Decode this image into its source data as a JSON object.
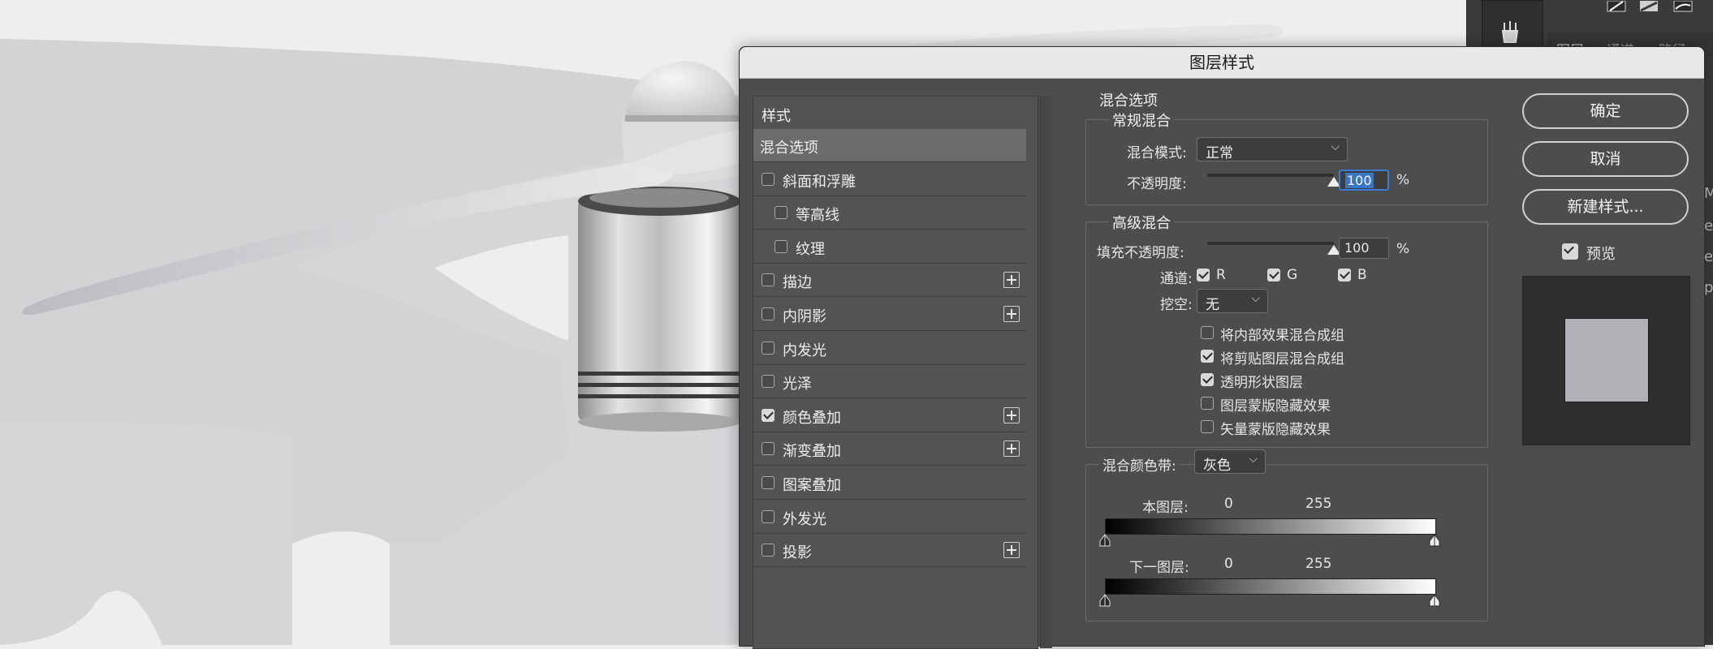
{
  "dialog": {
    "title": "图层样式",
    "styles_list": {
      "header": "样式",
      "items": [
        {
          "label": "混合选项",
          "has_checkbox": false,
          "checked": false,
          "has_plus": false,
          "selected": true,
          "indent": false
        },
        {
          "label": "斜面和浮雕",
          "has_checkbox": true,
          "checked": false,
          "has_plus": false,
          "selected": false,
          "indent": false
        },
        {
          "label": "等高线",
          "has_checkbox": true,
          "checked": false,
          "has_plus": false,
          "selected": false,
          "indent": true
        },
        {
          "label": "纹理",
          "has_checkbox": true,
          "checked": false,
          "has_plus": false,
          "selected": false,
          "indent": true
        },
        {
          "label": "描边",
          "has_checkbox": true,
          "checked": false,
          "has_plus": true,
          "selected": false,
          "indent": false
        },
        {
          "label": "内阴影",
          "has_checkbox": true,
          "checked": false,
          "has_plus": true,
          "selected": false,
          "indent": false
        },
        {
          "label": "内发光",
          "has_checkbox": true,
          "checked": false,
          "has_plus": false,
          "selected": false,
          "indent": false
        },
        {
          "label": "光泽",
          "has_checkbox": true,
          "checked": false,
          "has_plus": false,
          "selected": false,
          "indent": false
        },
        {
          "label": "颜色叠加",
          "has_checkbox": true,
          "checked": true,
          "has_plus": true,
          "selected": false,
          "indent": false
        },
        {
          "label": "渐变叠加",
          "has_checkbox": true,
          "checked": false,
          "has_plus": true,
          "selected": false,
          "indent": false
        },
        {
          "label": "图案叠加",
          "has_checkbox": true,
          "checked": false,
          "has_plus": false,
          "selected": false,
          "indent": false
        },
        {
          "label": "外发光",
          "has_checkbox": true,
          "checked": false,
          "has_plus": false,
          "selected": false,
          "indent": false
        },
        {
          "label": "投影",
          "has_checkbox": true,
          "checked": false,
          "has_plus": true,
          "selected": false,
          "indent": false
        }
      ]
    },
    "blending": {
      "section_title": "混合选项",
      "general": {
        "legend": "常规混合",
        "blend_mode_label": "混合模式:",
        "blend_mode_value": "正常",
        "opacity_label": "不透明度:",
        "opacity_value": "100",
        "opacity_unit": "%",
        "opacity_level": 1.0
      },
      "advanced": {
        "legend": "高级混合",
        "fill_opacity_label": "填充不透明度:",
        "fill_opacity_value": "100",
        "fill_opacity_unit": "%",
        "fill_opacity_level": 1.0,
        "channels_label": "通道:",
        "channels": [
          {
            "label": "R",
            "checked": true
          },
          {
            "label": "G",
            "checked": true
          },
          {
            "label": "B",
            "checked": true
          }
        ],
        "knockout_label": "挖空:",
        "knockout_value": "无",
        "options": [
          {
            "label": "将内部效果混合成组",
            "checked": false
          },
          {
            "label": "将剪贴图层混合成组",
            "checked": true
          },
          {
            "label": "透明形状图层",
            "checked": true
          },
          {
            "label": "图层蒙版隐藏效果",
            "checked": false
          },
          {
            "label": "矢量蒙版隐藏效果",
            "checked": false
          }
        ]
      },
      "blend_if": {
        "label": "混合颜色带:",
        "value": "灰色",
        "this_layer_label": "本图层:",
        "this_layer_low": "0",
        "this_layer_high": "255",
        "underlying_label": "下一图层:",
        "underlying_low": "0",
        "underlying_high": "255"
      }
    },
    "buttons": {
      "ok": "确定",
      "cancel": "取消",
      "new_style": "新建样式...",
      "preview_label": "预览",
      "preview_checked": true
    },
    "preview_swatch_color": "#b0b0b6"
  },
  "app_panel": {
    "tabs": [
      "图层",
      "通道",
      "路径"
    ],
    "edge_glyphs": [
      "M",
      "er",
      "er",
      "p"
    ]
  },
  "colors": {
    "dialog_bg": "#4d4d4d",
    "titlebar_bg": "#e8e8e8",
    "canvas_bg": "#eeeeef",
    "artwork_shadow": "#d6d6d9",
    "focus_accent": "#3a7ad9"
  }
}
